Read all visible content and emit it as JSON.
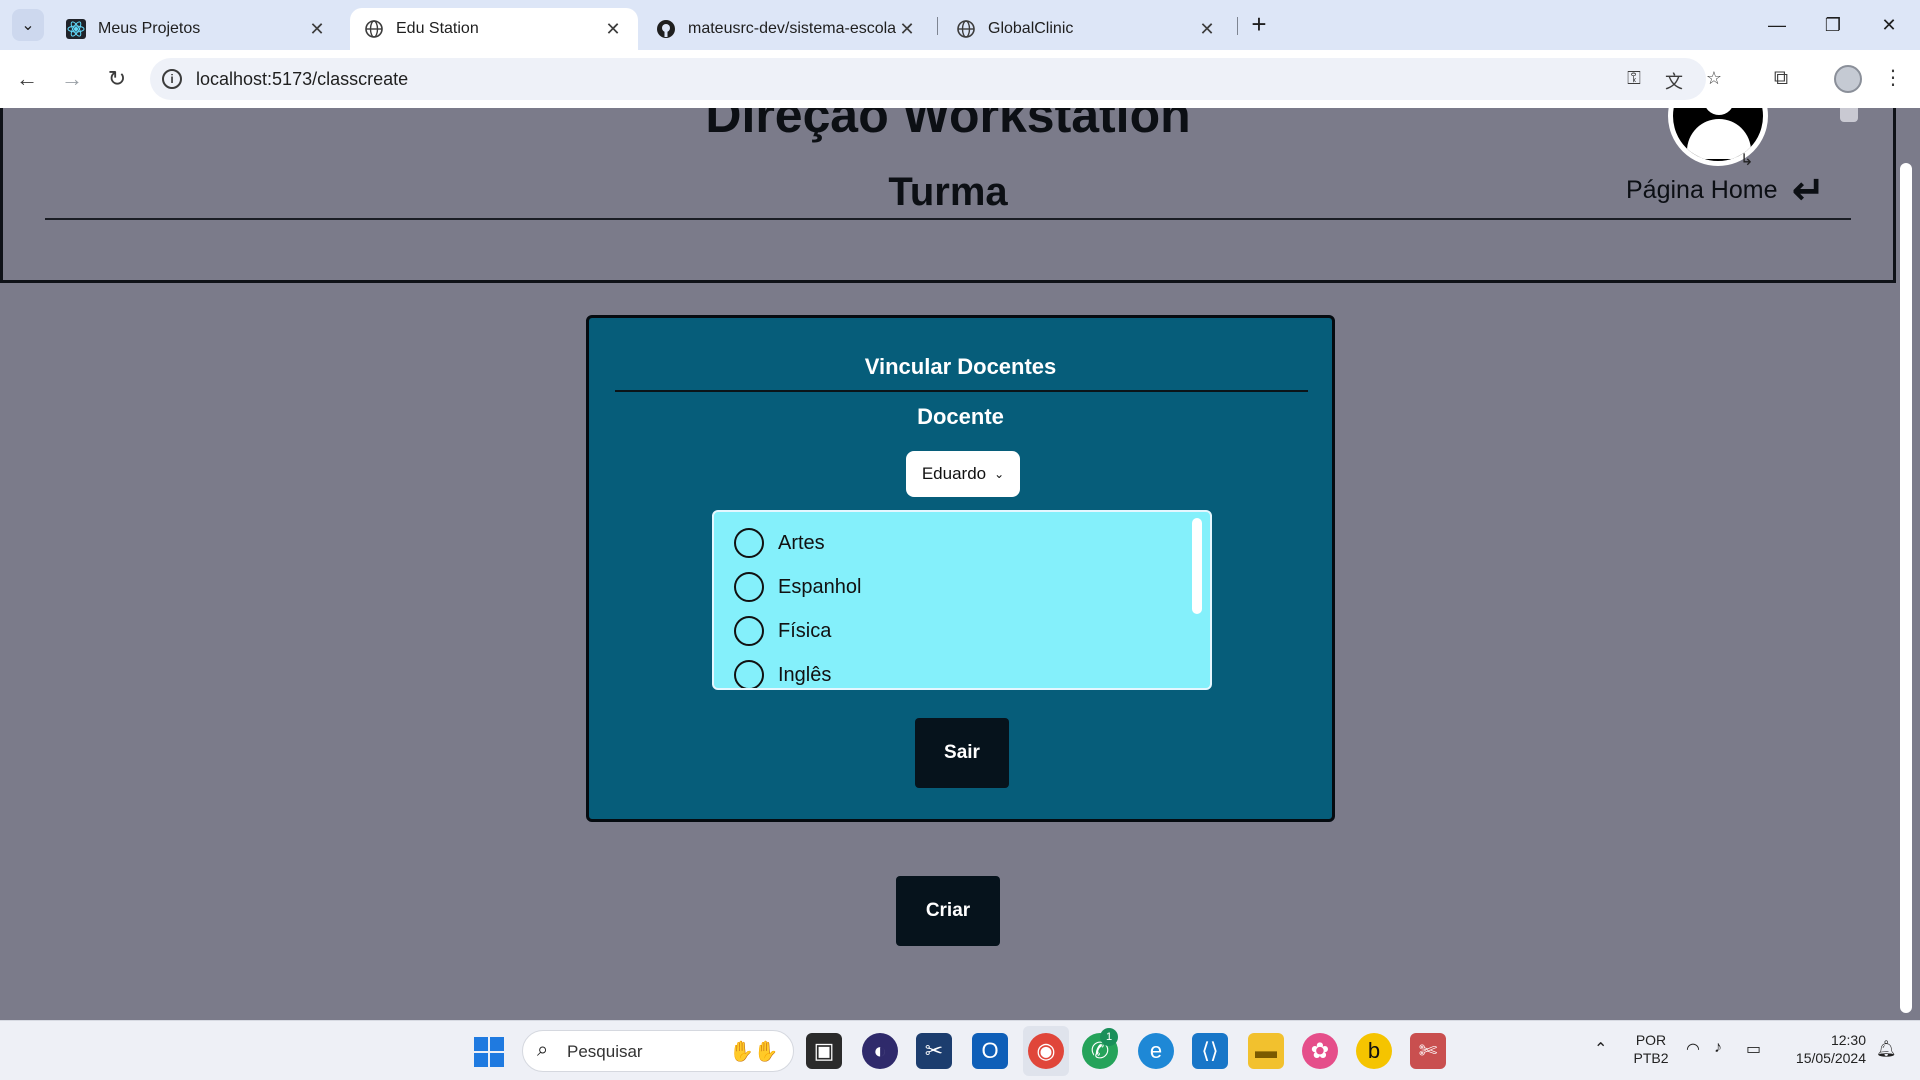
{
  "browser": {
    "tabs": [
      {
        "title": "Meus Projetos",
        "active": false
      },
      {
        "title": "Edu Station",
        "active": true
      },
      {
        "title": "mateusrc-dev/sistema-escolar-",
        "active": false
      },
      {
        "title": "GlobalClinic",
        "active": false
      }
    ],
    "url": "localhost:5173/classcreate"
  },
  "app": {
    "title": "Direção Workstation"
  },
  "page": {
    "section_title": "Turma",
    "home_link": "Página Home"
  },
  "card": {
    "title": "Vincular Docentes",
    "field_label": "Docente",
    "selected_docente": "Eduardo",
    "subjects": [
      "Artes",
      "Espanhol",
      "Física",
      "Inglês"
    ],
    "exit_button": "Sair"
  },
  "create_button": "Criar",
  "taskbar": {
    "search_placeholder": "Pesquisar",
    "language": "POR",
    "layout": "PTB2",
    "time": "12:30",
    "date": "15/05/2024",
    "whatsapp_badge": "1"
  },
  "colors": {
    "page_bg": "#7b7b8a",
    "card_bg": "#065d7a",
    "list_bg": "#84f0fb",
    "button_bg": "#06131c"
  }
}
